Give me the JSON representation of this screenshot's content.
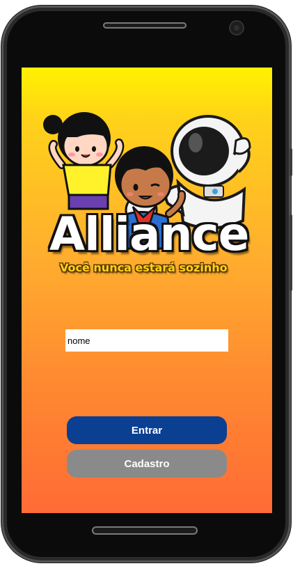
{
  "app": {
    "logo_text": "Alliance",
    "tagline": "Você nunca estará sozinho"
  },
  "form": {
    "name_placeholder": "nome"
  },
  "buttons": {
    "enter_label": "Entrar",
    "register_label": "Cadastro"
  },
  "colors": {
    "gradient_top": "#fff200",
    "gradient_bottom": "#ff6b35",
    "enter_button": "#0b3f91",
    "register_button": "#8a8a8a"
  }
}
